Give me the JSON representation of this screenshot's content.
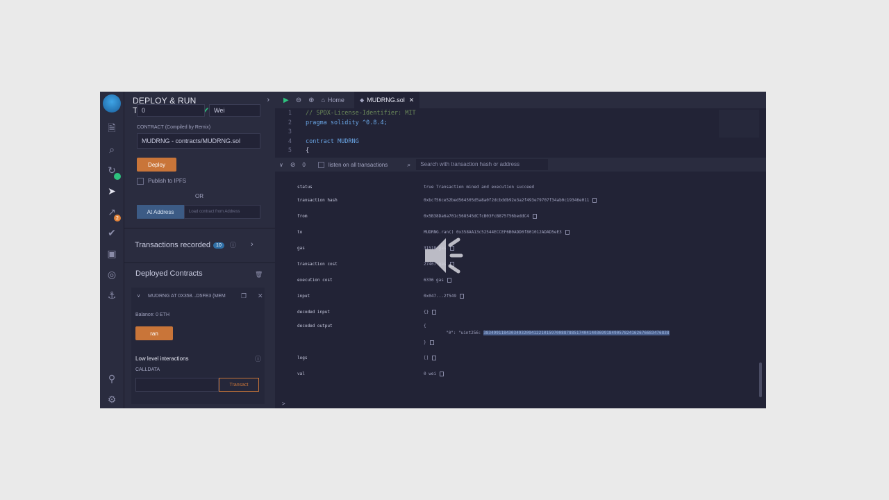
{
  "panel": {
    "title": "DEPLOY & RUN TRANSACTIONS",
    "value_field": "0",
    "unit_field": "Wei",
    "contract_label": "CONTRACT (Compiled by Remix)",
    "contract_select": "MUDRNG - contracts/MUDRNG.sol",
    "deploy_label": "Deploy",
    "publish_label": "Publish to IPFS",
    "or_label": "OR",
    "at_address_label": "At Address",
    "load_contract_placeholder": "Load contract from Address",
    "transactions_recorded_label": "Transactions recorded",
    "transactions_recorded_count": "10",
    "deployed_contracts_label": "Deployed Contracts",
    "instance": {
      "title": "MUDRNG AT 0X358...D5FE3 (MEM",
      "balance": "Balance: 0 ETH",
      "ran_label": "ran",
      "low_level_label": "Low level interactions",
      "calldata_label": "CALLDATA",
      "transact_label": "Transact"
    }
  },
  "rail": {
    "plugin_badge": "2"
  },
  "editor": {
    "home_tab": "Home",
    "file_tab": "MUDRNG.sol",
    "lines": [
      {
        "n": "1",
        "text": "// SPDX-License-Identifier: MIT",
        "kind": "comment"
      },
      {
        "n": "2",
        "text": "pragma solidity ^0.8.4;",
        "kind": "pragma"
      },
      {
        "n": "3",
        "text": "",
        "kind": "text"
      },
      {
        "n": "4",
        "text": "contract MUDRNG",
        "kind": "contract"
      },
      {
        "n": "5",
        "text": "{",
        "kind": "text"
      }
    ]
  },
  "terminal": {
    "count": "0",
    "listen_label": "listen on all transactions",
    "search_placeholder": "Search with transaction hash or address",
    "prompt": ">",
    "rows": [
      {
        "key": "status",
        "value": "true Transaction mined and execution succeed"
      },
      {
        "key": "transaction hash",
        "value": "0xbcf56ce52bed564505d5a8a0f2dcbddb92e3a2f493e79707f34ab0c19346e011"
      },
      {
        "key": "from",
        "value": "0x5B38Da6a701c568545dCfcB03FcB875f56beddC4"
      },
      {
        "key": "to",
        "value": "MUDRNG.ran() 0x358AA13c52544ECCEF6B0ADD0f801012ADAD5eE3"
      },
      {
        "key": "gas",
        "value": "31518 gas"
      },
      {
        "key": "transaction cost",
        "value": "27407 gas"
      },
      {
        "key": "execution cost",
        "value": "6336 gas"
      },
      {
        "key": "input",
        "value": "0x047...2f549"
      },
      {
        "key": "decoded input",
        "value": "{}"
      },
      {
        "key": "decoded output",
        "value": "{"
      },
      {
        "key": "",
        "value": "\"0\": \"uint256: "
      },
      {
        "key": "",
        "value": "}"
      },
      {
        "key": "logs",
        "value": "[]"
      },
      {
        "key": "val",
        "value": "0 wei"
      }
    ],
    "decoded_output_value": "38349911843034932094122101597008878851740414036991849057824162676683476838"
  }
}
